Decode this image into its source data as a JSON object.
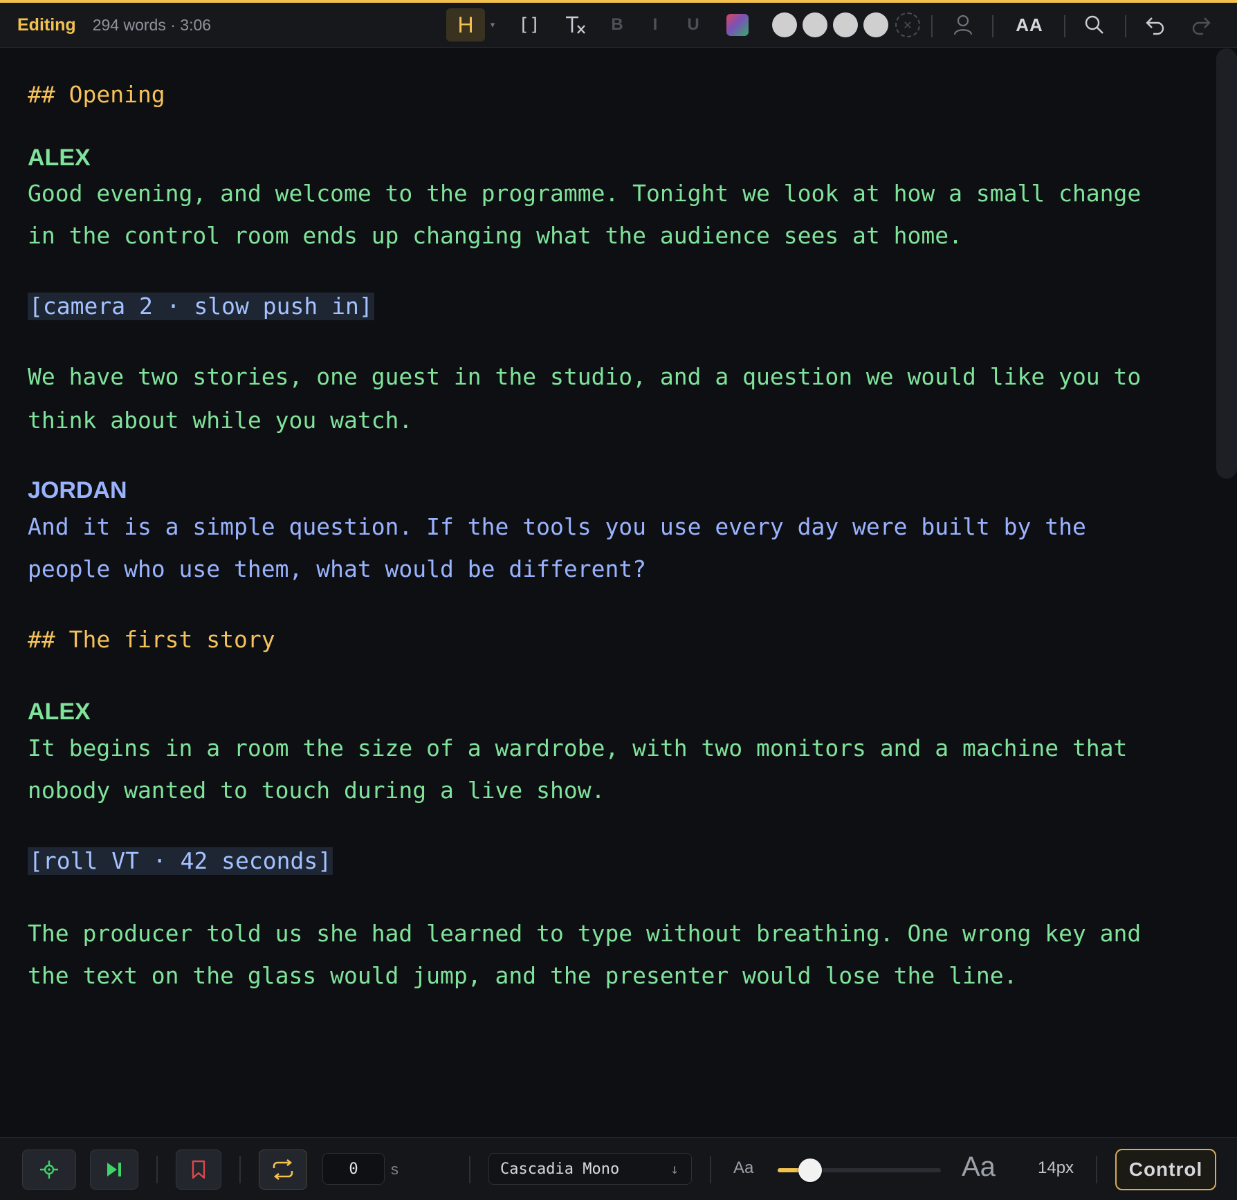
{
  "toolbar": {
    "mode": "Editing",
    "stats": "294 words · 3:06",
    "heading_button": "H",
    "bracket_button": "[]",
    "bold_button": "B",
    "italic_button": "I",
    "underline_button": "U",
    "text_size_button": "AA"
  },
  "script": {
    "lines": [
      "## Opening",
      "ALEX",
      "Good evening, and welcome to the programme. Tonight we look at how a small change",
      "in the control room ends up changing what the audience sees at home.",
      "[camera 2 · slow push in]",
      "We have two stories, one guest in the studio, and a question we would like you to",
      "think about while you watch.",
      "JORDAN",
      "And it is a simple question. If the tools you use every day were built by the",
      "people who use them, what would be different?",
      "## The first story",
      "ALEX",
      "It begins in a room the size of a wardrobe, with two monitors and a machine that",
      "nobody wanted to touch during a live show.",
      "[roll VT · 42 seconds]",
      "The producer told us she had learned to type without breathing. One wrong key and",
      "the text on the glass would jump, and the presenter would lose the line."
    ]
  },
  "controls": {
    "interval_value": "0",
    "interval_unit": "s",
    "font_name": "Cascadia Mono",
    "font_arrow": "↓",
    "size_small_label": "Aa",
    "size_large_label": "Aa",
    "font_size_value": 0.2,
    "font_size_readout": "14px",
    "control_button": "Control"
  },
  "colors": {
    "accent": "#f2c14e",
    "heading": "#f4c15a",
    "alex": "#7fe39b",
    "jordan": "#9ab3ff",
    "cue": "#a4c2ff",
    "bookmark": "#e0474c",
    "play_green": "#3ed46a"
  },
  "icons": {
    "clear_format": "clear-format-icon",
    "color_palette": "color-palette-icon",
    "person": "person-icon",
    "search": "search-icon",
    "undo": "undo-icon",
    "redo": "redo-icon",
    "crosshair": "crosshair-icon",
    "skip": "skip-next-icon",
    "bookmark": "bookmark-icon",
    "loop": "loop-icon"
  }
}
